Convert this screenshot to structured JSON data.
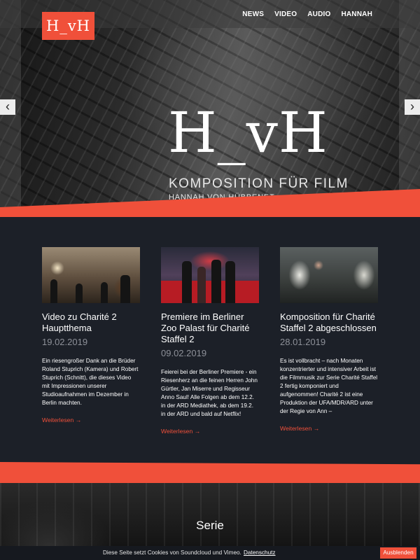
{
  "header": {
    "logo": "H_vH",
    "nav": [
      "NEWS",
      "VIDEO",
      "AUDIO",
      "HANNAH"
    ]
  },
  "hero": {
    "title": "H_vH",
    "subtitle": "KOMPOSITION FÜR FILM",
    "name": "HANNAH VON HÜBBENET",
    "prev_icon": "chevron-left-icon",
    "next_icon": "chevron-right-icon",
    "prev_glyph": "‹",
    "next_glyph": "›"
  },
  "news": [
    {
      "title": "Video zu Charité 2 Hauptthema",
      "date": "19.02.2019",
      "text": "Ein riesengroßer Dank an die Brüder Roland Stuprich (Kamera) und Robert Stuprich (Schnitt), die dieses Video mit Impressionen unserer Studioaufnahmen im Dezember in Berlin machten.",
      "more": "Weiterlesen →"
    },
    {
      "title": "Premiere im Berliner Zoo Palast für Charité Staffel 2",
      "date": "09.02.2019",
      "text": "Feierei bei der Berliner Premiere - ein Riesenherz an die feinen Herren John Gürtler, Jan Miserre und Regisseur Anno Saul! Alle Folgen ab dem 12.2. in der ARD Mediathek, ab dem 19.2. in der ARD und bald auf Netflix!",
      "more": "Weiterlesen →"
    },
    {
      "title": "Komposition für Charité Staffel 2 abgeschlossen",
      "date": "28.01.2019",
      "text": "Es ist vollbracht – nach Monaten konzentrierter und intensiver Arbeit ist die Filmmusik zur Serie Charité Staffel 2 fertig komponiert und aufgenommen! Charité 2 ist eine Produktion der UFA/MDR/ARD unter der Regie von Ann –",
      "more": "Weiterlesen →"
    }
  ],
  "section": {
    "title": "Serie"
  },
  "cookie": {
    "text": "Diese Seite setzt Cookies von Soundcloud und Vimeo.",
    "link": "Datenschutz",
    "button": "Ausblenden"
  },
  "colors": {
    "accent": "#f0503a",
    "dark": "#1c2028"
  }
}
